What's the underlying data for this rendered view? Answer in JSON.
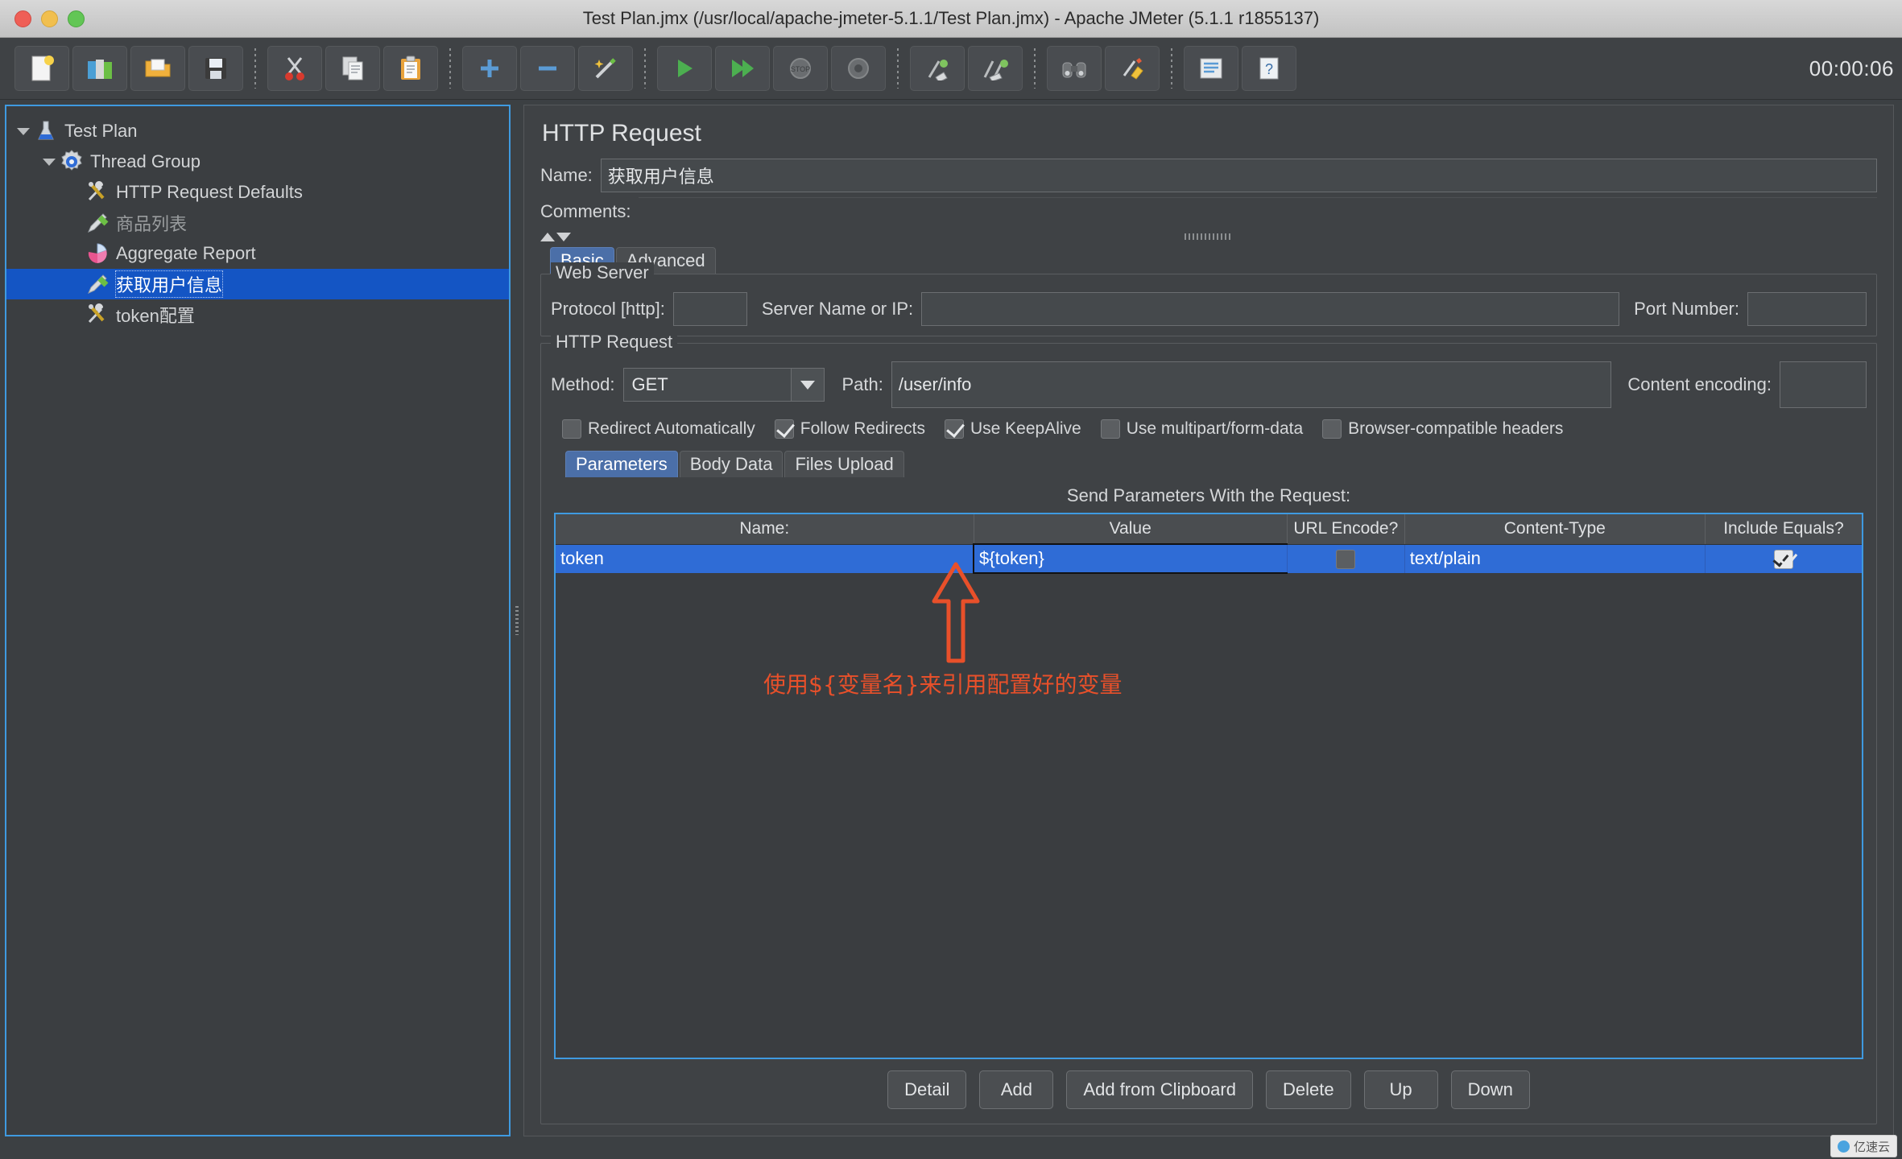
{
  "window": {
    "title": "Test Plan.jmx (/usr/local/apache-jmeter-5.1.1/Test Plan.jmx) - Apache JMeter (5.1.1 r1855137)",
    "timer": "00:00:06"
  },
  "toolbar": {
    "buttons": [
      {
        "name": "new",
        "icon": "new-document-icon"
      },
      {
        "name": "templates",
        "icon": "templates-icon"
      },
      {
        "name": "open",
        "icon": "open-folder-icon"
      },
      {
        "name": "save",
        "icon": "save-floppy-icon"
      },
      {
        "name": "cut",
        "icon": "scissors-icon"
      },
      {
        "name": "copy",
        "icon": "copy-pages-icon"
      },
      {
        "name": "paste",
        "icon": "clipboard-icon"
      },
      {
        "name": "expand",
        "icon": "plus-icon"
      },
      {
        "name": "collapse",
        "icon": "minus-icon"
      },
      {
        "name": "toggle",
        "icon": "wand-icon"
      },
      {
        "name": "start",
        "icon": "play-green-icon"
      },
      {
        "name": "start-no-pauses",
        "icon": "play-no-pause-icon"
      },
      {
        "name": "stop",
        "icon": "stop-icon"
      },
      {
        "name": "shutdown",
        "icon": "shutdown-icon"
      },
      {
        "name": "clear",
        "icon": "broom-single-icon"
      },
      {
        "name": "clear-all",
        "icon": "broom-all-icon"
      },
      {
        "name": "search",
        "icon": "binoculars-icon"
      },
      {
        "name": "reset-search",
        "icon": "eraser-icon"
      },
      {
        "name": "function-helper",
        "icon": "list-icon"
      },
      {
        "name": "help",
        "icon": "help-question-icon"
      }
    ]
  },
  "tree": {
    "items": [
      {
        "label": "Test Plan",
        "indent": 0,
        "arrow": true,
        "icon": "flask-icon",
        "state": "normal"
      },
      {
        "label": "Thread Group",
        "indent": 1,
        "arrow": true,
        "icon": "gear-shield-icon",
        "state": "normal"
      },
      {
        "label": "HTTP Request Defaults",
        "indent": 2,
        "arrow": false,
        "icon": "tools-icon",
        "state": "normal"
      },
      {
        "label": "商品列表",
        "indent": 2,
        "arrow": false,
        "icon": "pencil-green-icon",
        "state": "disabled"
      },
      {
        "label": "Aggregate Report",
        "indent": 2,
        "arrow": false,
        "icon": "chart-pink-icon",
        "state": "normal"
      },
      {
        "label": "获取用户信息",
        "indent": 2,
        "arrow": false,
        "icon": "pencil-green-icon",
        "state": "selected"
      },
      {
        "label": "token配置",
        "indent": 2,
        "arrow": false,
        "icon": "tools-icon",
        "state": "normal"
      }
    ]
  },
  "panel": {
    "title": "HTTP Request",
    "name_label": "Name:",
    "name_value": "获取用户信息",
    "comments_label": "Comments:",
    "comments_value": "",
    "tabs": [
      {
        "label": "Basic",
        "active": true
      },
      {
        "label": "Advanced",
        "active": false
      }
    ],
    "web_server": {
      "legend": "Web Server",
      "protocol_label": "Protocol [http]:",
      "protocol_value": "",
      "server_label": "Server Name or IP:",
      "server_value": "",
      "port_label": "Port Number:",
      "port_value": ""
    },
    "http_request": {
      "legend": "HTTP Request",
      "method_label": "Method:",
      "method_value": "GET",
      "path_label": "Path:",
      "path_value": "/user/info",
      "content_encoding_label": "Content encoding:",
      "content_encoding_value": "",
      "checkboxes": [
        {
          "label": "Redirect Automatically",
          "checked": false
        },
        {
          "label": "Follow Redirects",
          "checked": true
        },
        {
          "label": "Use KeepAlive",
          "checked": true
        },
        {
          "label": "Use multipart/form-data",
          "checked": false
        },
        {
          "label": "Browser-compatible headers",
          "checked": false
        }
      ],
      "param_tabs": [
        {
          "label": "Parameters",
          "active": true
        },
        {
          "label": "Body Data",
          "active": false
        },
        {
          "label": "Files Upload",
          "active": false
        }
      ],
      "send_params_label": "Send Parameters With the Request:",
      "table": {
        "headers": [
          "Name:",
          "Value",
          "URL Encode?",
          "Content-Type",
          "Include Equals?"
        ],
        "rows": [
          {
            "name": "token",
            "value": "${token}",
            "url_encode": false,
            "content_type": "text/plain",
            "include_equals": true
          }
        ]
      },
      "buttons": [
        {
          "label": "Detail"
        },
        {
          "label": "Add"
        },
        {
          "label": "Add from Clipboard"
        },
        {
          "label": "Delete"
        },
        {
          "label": "Up"
        },
        {
          "label": "Down"
        }
      ]
    }
  },
  "annotation": {
    "text": "使用${变量名}来引用配置好的变量",
    "color": "#e8502a"
  },
  "watermark": {
    "text": "亿速云"
  },
  "colors": {
    "selection_blue": "#1455c4",
    "table_selection": "#2f6cd6",
    "panel_border_focus": "#3f9ae0"
  }
}
